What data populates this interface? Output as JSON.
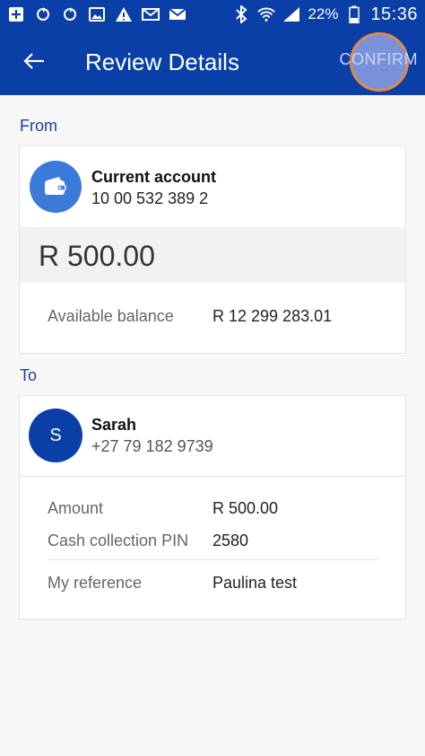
{
  "status_bar": {
    "battery": "22%",
    "time": "15:36"
  },
  "app_bar": {
    "title": "Review Details",
    "confirm": "CONFIRM"
  },
  "from": {
    "label": "From",
    "account_name": "Current account",
    "account_number": "10 00 532 389 2",
    "amount": "R 500.00",
    "balance_label": "Available balance",
    "balance_value": "R 12 299 283.01"
  },
  "to": {
    "label": "To",
    "initial": "S",
    "name": "Sarah",
    "phone": "+27 79 182 9739",
    "details": [
      {
        "label": "Amount",
        "value": "R 500.00"
      },
      {
        "label": "Cash collection PIN",
        "value": "2580"
      },
      {
        "label": "My reference",
        "value": "Paulina test"
      }
    ]
  },
  "colors": {
    "primary": "#0a3fa8",
    "wallet_avatar": "#3a7ad8",
    "section_label": "#1b3fa0"
  },
  "icons": [
    "add-box-icon",
    "sync-icon",
    "sync-icon",
    "image-icon",
    "warning-icon",
    "mail-icon",
    "mail-icon",
    "bluetooth-icon",
    "wifi-icon",
    "signal-icon",
    "battery-icon",
    "back-arrow-icon",
    "wallet-icon"
  ]
}
